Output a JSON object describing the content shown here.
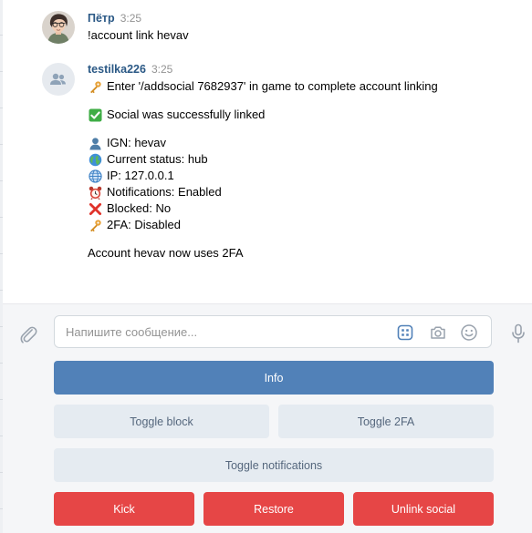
{
  "messages": [
    {
      "author": "Пётр",
      "time": "3:25",
      "avatar_icon": "user-photo-avatar",
      "text": "!account link hevav"
    },
    {
      "author": "testilka226",
      "time": "3:25",
      "avatar_icon": "group-avatar",
      "lines": {
        "instruction": "Enter '/addsocial 7682937' in game to complete account linking",
        "linked": "Social was successfully linked",
        "ign": "IGN: hevav",
        "status": "Current status: hub",
        "ip": "IP: 127.0.0.1",
        "notifications": "Notifications: Enabled",
        "blocked": "Blocked: No",
        "twofa": "2FA: Disabled",
        "uses_2fa": "Account hevav now uses 2FA"
      },
      "emoji_icons": {
        "instruction": "key-emoji",
        "linked": "check-mark-emoji",
        "ign": "bust-silhouette-emoji",
        "status": "globe-emoji",
        "ip": "globe-meridians-emoji",
        "notifications": "alarm-clock-emoji",
        "blocked": "cross-mark-emoji",
        "twofa": "key-emoji"
      }
    }
  ],
  "composer": {
    "placeholder": "Напишите сообщение...",
    "icons": [
      "paperclip-icon",
      "keyboard-icon",
      "camera-icon",
      "emoji-icon",
      "microphone-icon"
    ]
  },
  "keyboard": {
    "info": "Info",
    "toggle_block": "Toggle block",
    "toggle_2fa": "Toggle 2FA",
    "toggle_notifications": "Toggle notifications",
    "kick": "Kick",
    "restore": "Restore",
    "unlink_social": "Unlink social"
  },
  "colors": {
    "author_link": "#2a5885",
    "primary_button": "#5181b8",
    "secondary_button": "#e5ebf1",
    "negative_button": "#e64646",
    "composer_bg": "#f5f6f8"
  }
}
